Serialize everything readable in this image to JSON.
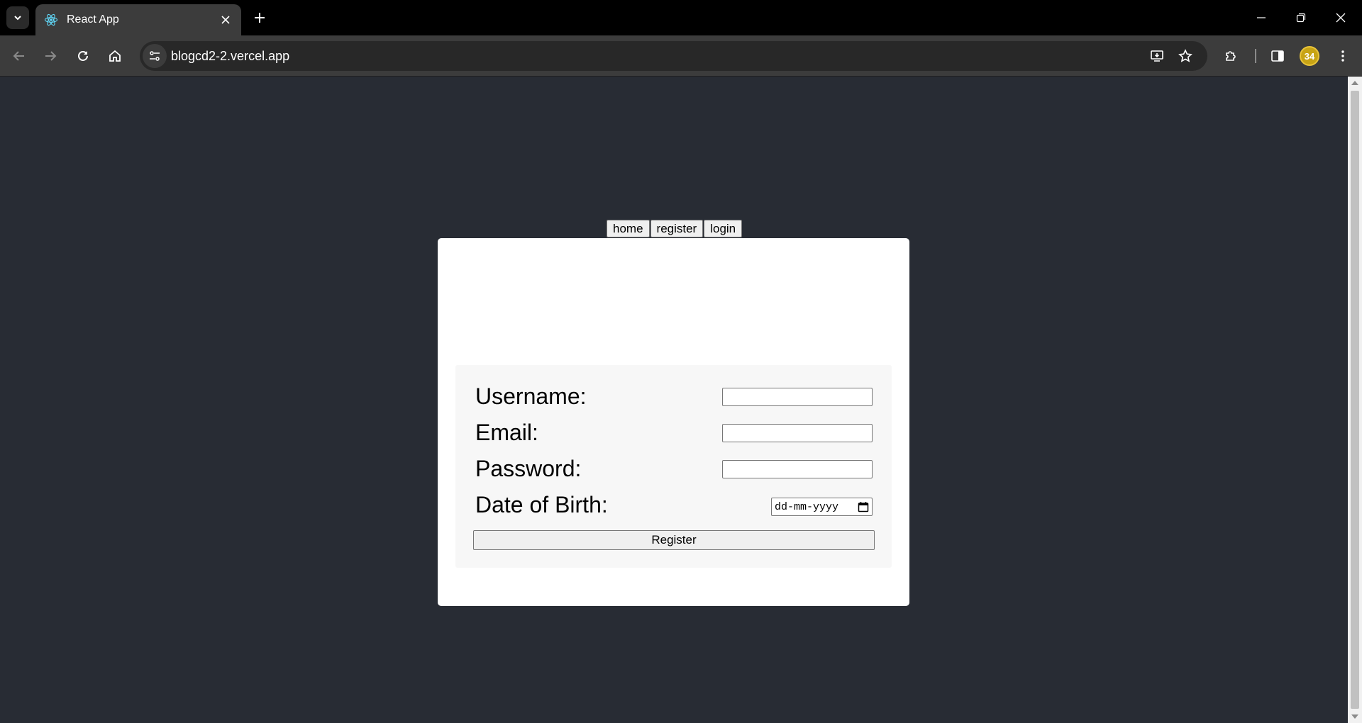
{
  "browser": {
    "tab_title": "React App",
    "url": "blogcd2-2.vercel.app",
    "profile_badge": "34",
    "icons": {
      "tab_list": "chevron-down-icon",
      "favicon": "react-logo-icon",
      "tab_close": "close-icon",
      "new_tab": "plus-icon",
      "back": "arrow-left-icon",
      "forward": "arrow-right-icon",
      "reload": "reload-icon",
      "home": "home-icon",
      "site_info": "tune-icon",
      "install": "install-app-icon",
      "bookmark": "star-icon",
      "extensions": "puzzle-icon",
      "side_panel": "side-panel-icon",
      "menu": "kebab-menu-icon",
      "minimize": "minimize-icon",
      "restore": "restore-icon",
      "close_window": "close-icon"
    }
  },
  "nav": {
    "home": "home",
    "register": "register",
    "login": "login"
  },
  "form": {
    "username_label": "Username:",
    "email_label": "Email:",
    "password_label": "Password:",
    "dob_label": "Date of Birth:",
    "dob_placeholder": "dd-mm-yyyy",
    "submit_label": "Register"
  },
  "colors": {
    "page_background": "#282c34",
    "card_background": "#ffffff",
    "form_background": "#f7f7f7"
  }
}
